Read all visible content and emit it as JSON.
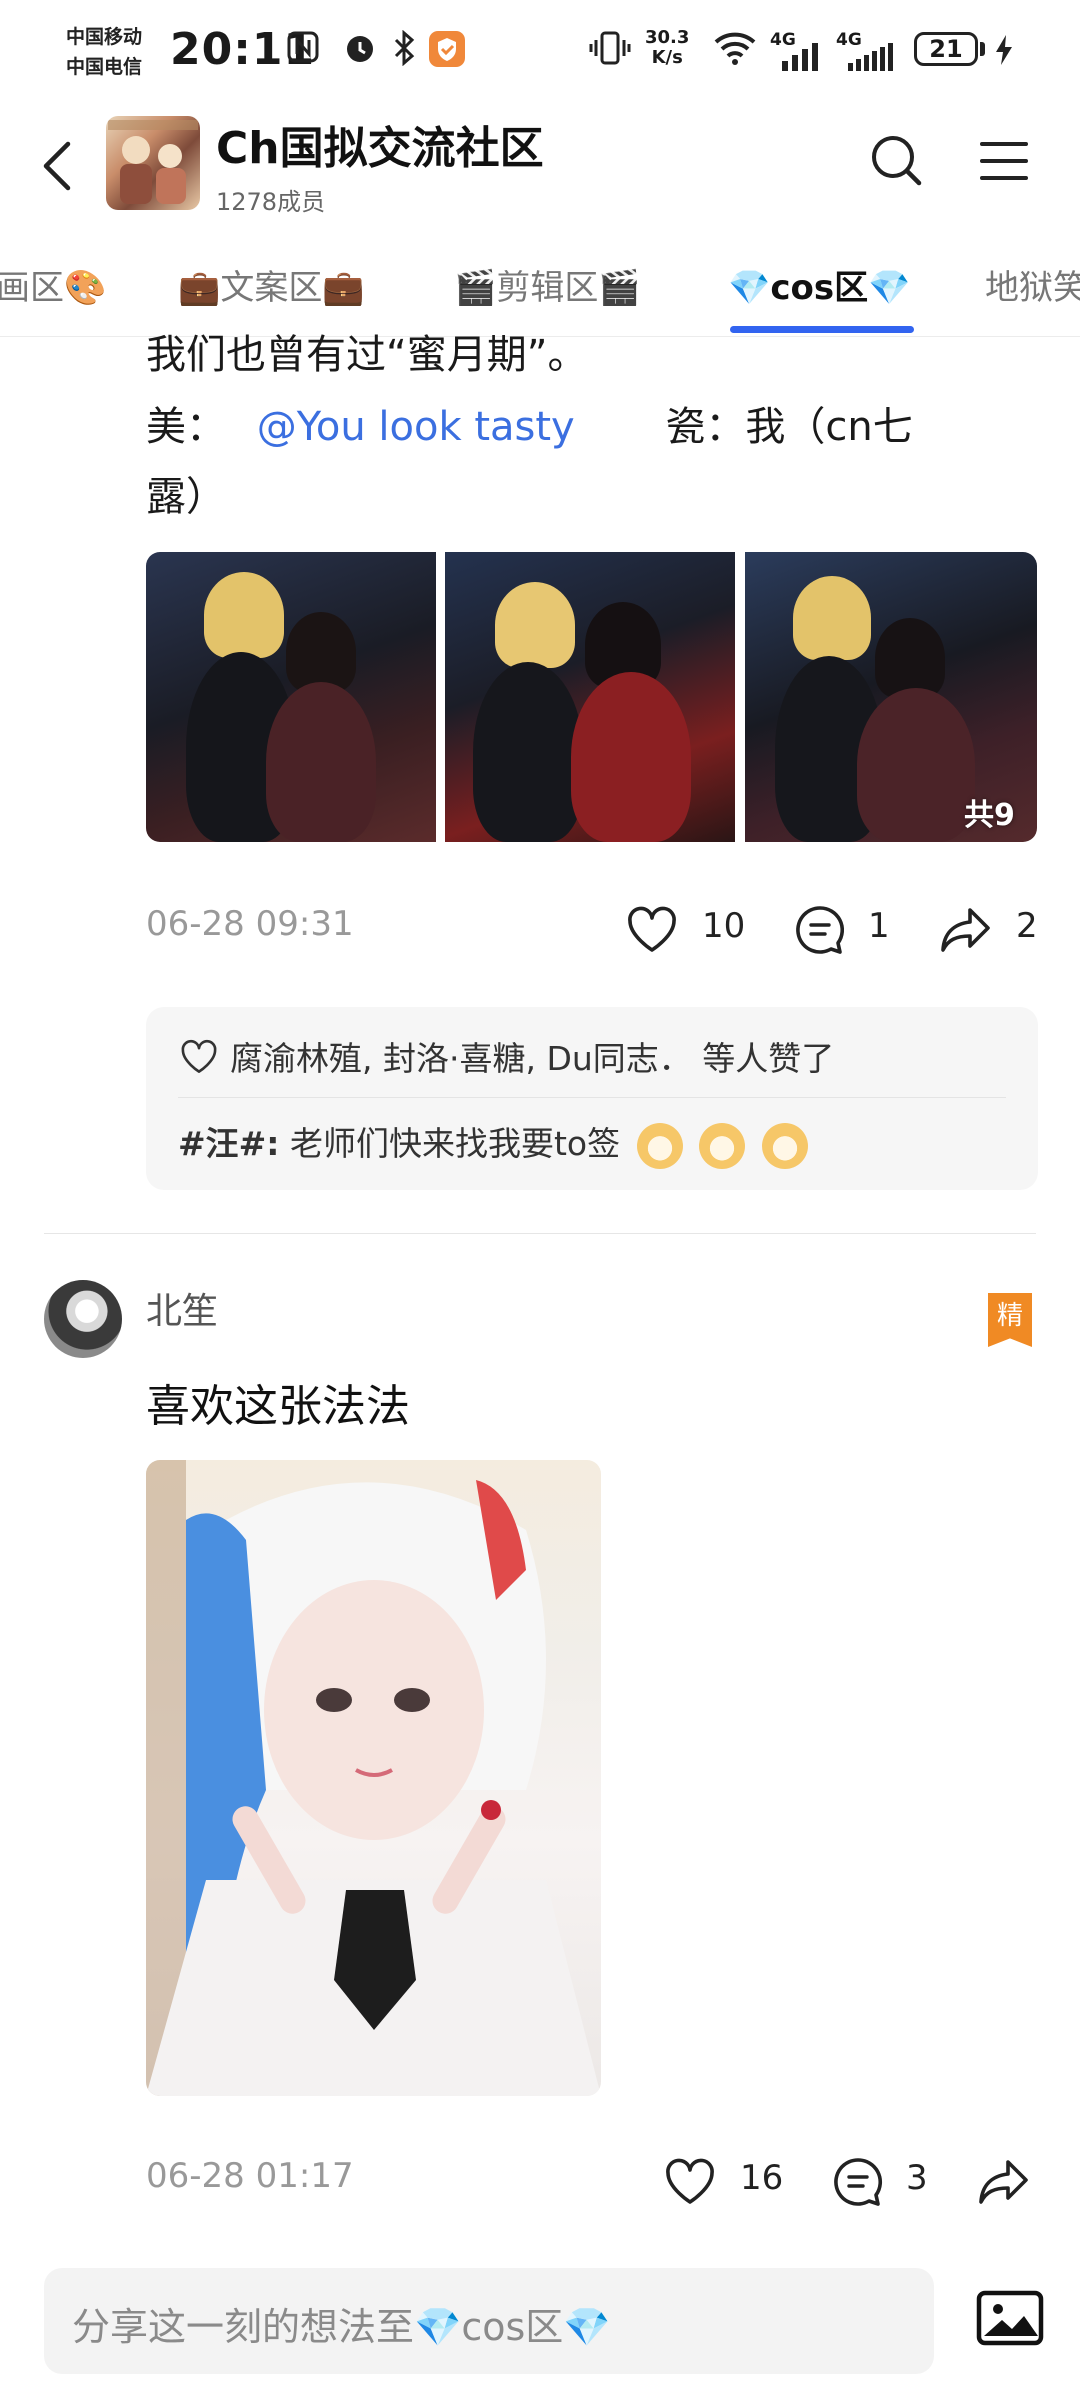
{
  "status_bar": {
    "carrier_1": "中国移动",
    "carrier_2": "中国电信",
    "time": "20:11",
    "net_speed_value": "30.3",
    "net_speed_unit": "K/s",
    "network_1": "4G",
    "network_2": "4G",
    "battery": "21"
  },
  "header": {
    "title": "Ch国拟交流社区",
    "members": "1278成员"
  },
  "tabs": [
    {
      "label": "画区🎨"
    },
    {
      "label": "💼文案区💼"
    },
    {
      "label": "🎬剪辑区🎬"
    },
    {
      "label": "💎cos区💎",
      "active": true
    },
    {
      "label": "地狱笑"
    }
  ],
  "post1": {
    "line1": "我们也曾有过“蜜月期”。",
    "line2_prefix": "美：",
    "mention": "@You look tasty",
    "line2_suffix": "瓷：我（cn七",
    "line3": "露）",
    "image_count": "共9",
    "time": "06-28 09:31",
    "likes": "10",
    "comments": "1",
    "shares": "2",
    "liked_by": "腐渝林殖, 封洛·喜糖, Du同志．  等人赞了",
    "comment_user": "#汪#:",
    "comment_text": " 老师们快来找我要to签"
  },
  "post2": {
    "author": "北笙",
    "badge": "精",
    "text": "喜欢这张法法",
    "time": "06-28 01:17",
    "likes": "16",
    "comments": "3"
  },
  "composer": {
    "placeholder": "分享这一刻的想法至💎cos区💎"
  },
  "colors": {
    "accent_blue": "#3264f0",
    "mention_blue": "#3b6fe0",
    "badge_orange": "#f08a24"
  }
}
